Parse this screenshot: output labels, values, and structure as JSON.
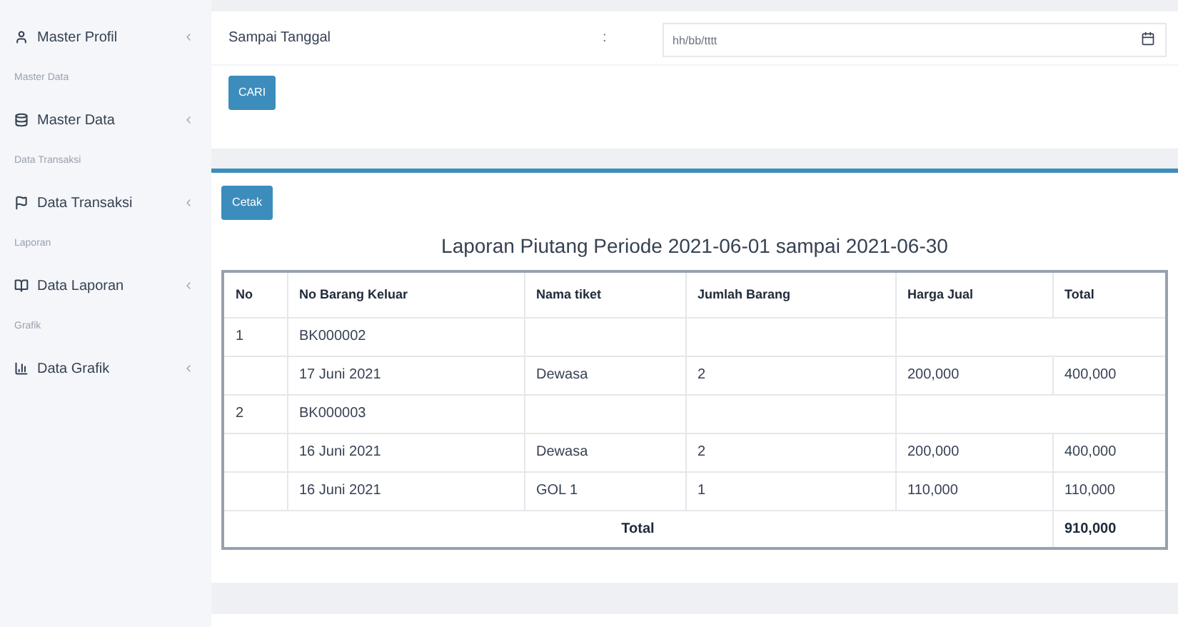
{
  "sidebar": {
    "items": [
      {
        "kind": "item",
        "label": "Master Profil"
      },
      {
        "kind": "header",
        "label": "Master Data"
      },
      {
        "kind": "item",
        "label": "Master Data"
      },
      {
        "kind": "header",
        "label": "Data Transaksi"
      },
      {
        "kind": "item",
        "label": "Data Transaksi"
      },
      {
        "kind": "header",
        "label": "Laporan"
      },
      {
        "kind": "item",
        "label": "Data Laporan"
      },
      {
        "kind": "header",
        "label": "Grafik"
      },
      {
        "kind": "item",
        "label": "Data Grafik"
      }
    ]
  },
  "filter": {
    "label": "Sampai Tanggal",
    "separator": ":",
    "date_placeholder": "hh/bb/tttt",
    "button": "CARI"
  },
  "report": {
    "print_button": "Cetak",
    "title": "Laporan Piutang Periode 2021-06-01 sampai 2021-06-30",
    "columns": [
      "No",
      "No Barang Keluar",
      "Nama tiket",
      "Jumlah Barang",
      "Harga Jual",
      "Total"
    ],
    "rows": [
      {
        "kind": "item",
        "no": "1",
        "code": "BK000002"
      },
      {
        "kind": "detail",
        "date": "17 Juni 2021",
        "name": "Dewasa",
        "qty": "2",
        "price": "200,000",
        "total": "400,000"
      },
      {
        "kind": "item",
        "no": "2",
        "code": "BK000003"
      },
      {
        "kind": "detail",
        "date": "16 Juni 2021",
        "name": "Dewasa",
        "qty": "2",
        "price": "200,000",
        "total": "400,000"
      },
      {
        "kind": "detail",
        "date": "16 Juni 2021",
        "name": "GOL 1",
        "qty": "1",
        "price": "110,000",
        "total": "110,000"
      }
    ],
    "footer": {
      "label": "Total",
      "value": "910,000"
    }
  }
}
